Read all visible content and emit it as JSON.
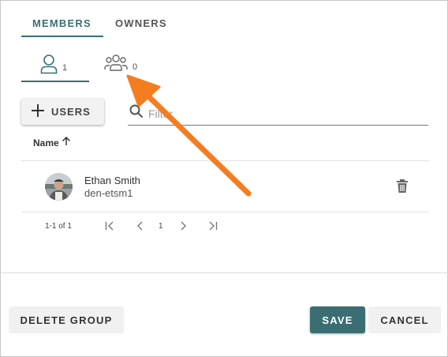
{
  "tabs": {
    "members": "MEMBERS",
    "owners": "OWNERS"
  },
  "subtabs": {
    "users_count": "1",
    "groups_count": "0"
  },
  "toolbar": {
    "add_users_label": "USERS",
    "filter_placeholder": "Filter"
  },
  "table": {
    "name_header": "Name",
    "rows": [
      {
        "name": "Ethan Smith",
        "id": "den-etsm1"
      }
    ]
  },
  "pagination": {
    "range": "1-1 of 1",
    "page": "1"
  },
  "footer": {
    "delete_label": "DELETE GROUP",
    "save_label": "SAVE",
    "cancel_label": "CANCEL"
  },
  "colors": {
    "accent": "#3b6e73",
    "annotation_arrow": "#f47d20"
  },
  "icons": [
    "user-icon",
    "group-icon",
    "plus-icon",
    "search-icon",
    "arrow-up-icon",
    "trash-icon",
    "first-page-icon",
    "prev-page-icon",
    "next-page-icon",
    "last-page-icon"
  ]
}
